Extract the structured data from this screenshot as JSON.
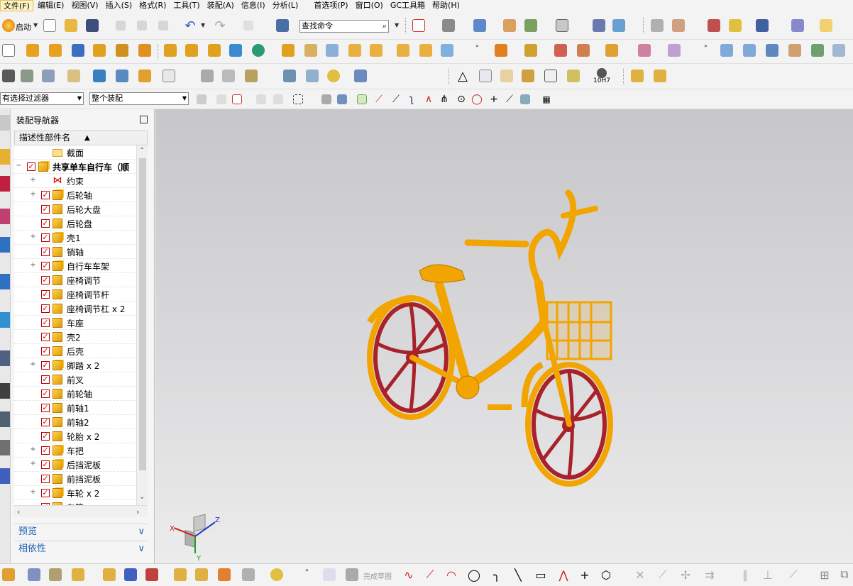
{
  "menu": [
    "文件(F)",
    "编辑(E)",
    "视图(V)",
    "插入(S)",
    "格式(R)",
    "工具(T)",
    "装配(A)",
    "信息(I)",
    "分析(L)",
    "首选项(P)",
    "窗口(O)",
    "GC工具箱",
    "帮助(H)"
  ],
  "toolbar": {
    "start_label": "启动",
    "search_placeholder": "查找命令",
    "hole_label": "10H7"
  },
  "selection_bar": {
    "filter_value": "有选择过滤器",
    "scope_value": "整个装配"
  },
  "navigator": {
    "title": "装配导航器",
    "column_header": "描述性部件名",
    "items": [
      {
        "label": "截面",
        "indent": 1,
        "expander": "",
        "checkbox": false,
        "icon": "folder-icon",
        "bold": false
      },
      {
        "label": "共享单车自行车（顺",
        "indent": 0,
        "expander": "−",
        "checkbox": true,
        "icon": "assembly-icon",
        "bold": true
      },
      {
        "label": "约束",
        "indent": 1,
        "expander": "+",
        "checkbox": false,
        "icon": "constraint-icon",
        "bold": false
      },
      {
        "label": "后轮轴",
        "indent": 1,
        "expander": "+",
        "checkbox": true,
        "icon": "assembly-icon",
        "bold": false
      },
      {
        "label": "后轮大盘",
        "indent": 1,
        "expander": "",
        "checkbox": true,
        "icon": "part-icon",
        "bold": false
      },
      {
        "label": "后轮盘",
        "indent": 1,
        "expander": "",
        "checkbox": true,
        "icon": "part-icon",
        "bold": false
      },
      {
        "label": "壳1",
        "indent": 1,
        "expander": "+",
        "checkbox": true,
        "icon": "assembly-icon",
        "bold": false
      },
      {
        "label": "销轴",
        "indent": 1,
        "expander": "",
        "checkbox": true,
        "icon": "part-icon",
        "bold": false
      },
      {
        "label": "自行车车架",
        "indent": 1,
        "expander": "+",
        "checkbox": true,
        "icon": "assembly-icon",
        "bold": false
      },
      {
        "label": "座椅调节",
        "indent": 1,
        "expander": "",
        "checkbox": true,
        "icon": "part-icon",
        "bold": false
      },
      {
        "label": "座椅调节杆",
        "indent": 1,
        "expander": "",
        "checkbox": true,
        "icon": "part-icon",
        "bold": false
      },
      {
        "label": "座椅调节杠 x 2",
        "indent": 1,
        "expander": "",
        "checkbox": true,
        "icon": "part-icon",
        "bold": false
      },
      {
        "label": "车座",
        "indent": 1,
        "expander": "",
        "checkbox": true,
        "icon": "part-icon",
        "bold": false
      },
      {
        "label": "壳2",
        "indent": 1,
        "expander": "",
        "checkbox": true,
        "icon": "part-icon",
        "bold": false
      },
      {
        "label": "后壳",
        "indent": 1,
        "expander": "",
        "checkbox": true,
        "icon": "part-icon",
        "bold": false
      },
      {
        "label": "脚踏 x 2",
        "indent": 1,
        "expander": "+",
        "checkbox": true,
        "icon": "assembly-icon",
        "bold": false
      },
      {
        "label": "前叉",
        "indent": 1,
        "expander": "",
        "checkbox": true,
        "icon": "part-icon",
        "bold": false
      },
      {
        "label": "前轮轴",
        "indent": 1,
        "expander": "",
        "checkbox": true,
        "icon": "part-icon",
        "bold": false
      },
      {
        "label": "前轴1",
        "indent": 1,
        "expander": "",
        "checkbox": true,
        "icon": "part-icon",
        "bold": false
      },
      {
        "label": "前轴2",
        "indent": 1,
        "expander": "",
        "checkbox": true,
        "icon": "part-icon",
        "bold": false
      },
      {
        "label": "轮胎 x 2",
        "indent": 1,
        "expander": "",
        "checkbox": true,
        "icon": "part-icon",
        "bold": false
      },
      {
        "label": "车把",
        "indent": 1,
        "expander": "+",
        "checkbox": true,
        "icon": "assembly-icon",
        "bold": false
      },
      {
        "label": "后挡泥板",
        "indent": 1,
        "expander": "+",
        "checkbox": true,
        "icon": "assembly-icon",
        "bold": false
      },
      {
        "label": "前挡泥板",
        "indent": 1,
        "expander": "",
        "checkbox": true,
        "icon": "part-icon",
        "bold": false
      },
      {
        "label": "车轮 x 2",
        "indent": 1,
        "expander": "+",
        "checkbox": true,
        "icon": "assembly-icon",
        "bold": false
      },
      {
        "label": "车筐",
        "indent": 1,
        "expander": "",
        "checkbox": true,
        "icon": "part-icon",
        "bold": false
      }
    ],
    "preview_label": "预览",
    "dependency_label": "相依性"
  },
  "triad": {
    "x_label": "X",
    "y_label": "Y",
    "z_label": "Z"
  },
  "bottom": {
    "finish_sketch_label": "完成草图"
  },
  "colors": {
    "part_yellow": "#f2a400",
    "rim_red": "#a8222a",
    "viewport_top": "#c7c7c9",
    "viewport_bottom": "#ececed",
    "link_blue": "#1a5fb4"
  }
}
